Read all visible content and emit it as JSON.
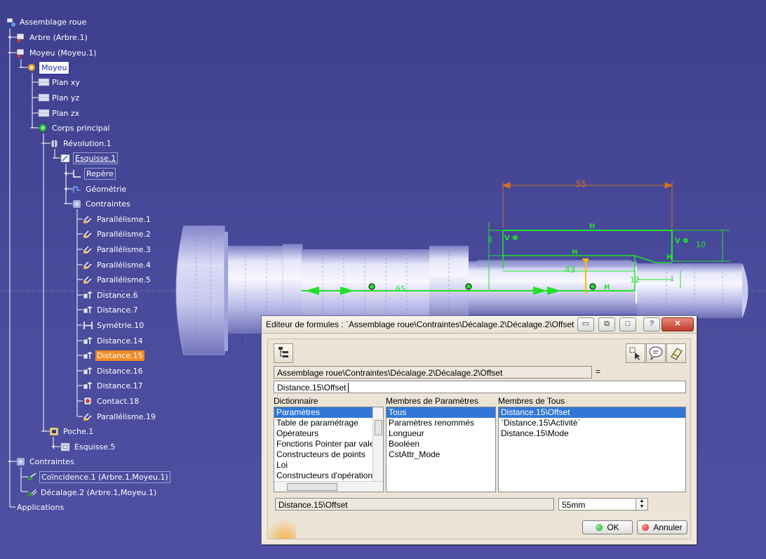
{
  "tree": {
    "items": [
      {
        "label": "Assemblage roue",
        "icon": "assembly-icon"
      },
      {
        "label": "Arbre (Arbre.1)",
        "icon": "product-icon"
      },
      {
        "label": "Moyeu (Moyeu.1)",
        "icon": "product-icon"
      },
      {
        "label": "Moyeu",
        "icon": "part-icon"
      },
      {
        "label": "Plan xy",
        "icon": "plane-icon"
      },
      {
        "label": "Plan yz",
        "icon": "plane-icon"
      },
      {
        "label": "Plan zx",
        "icon": "plane-icon"
      },
      {
        "label": "Corps principal",
        "icon": "body-icon"
      },
      {
        "label": "Révolution.1",
        "icon": "revolution-icon"
      },
      {
        "label": "Esquisse.1",
        "icon": "sketch-icon"
      },
      {
        "label": "Repère",
        "icon": "axis-icon"
      },
      {
        "label": "Géométrie",
        "icon": "geometry-icon"
      },
      {
        "label": "Contraintes",
        "icon": "constraints-icon"
      },
      {
        "label": "Parallélisme.1",
        "icon": "parallelism-icon"
      },
      {
        "label": "Parallélisme.2",
        "icon": "parallelism-icon"
      },
      {
        "label": "Parallélisme.3",
        "icon": "parallelism-icon"
      },
      {
        "label": "Parallélisme.4",
        "icon": "parallelism-icon"
      },
      {
        "label": "Parallélisme.5",
        "icon": "parallelism-icon"
      },
      {
        "label": "Distance.6",
        "icon": "distance-icon"
      },
      {
        "label": "Distance.7",
        "icon": "distance-icon"
      },
      {
        "label": "Symétrie.10",
        "icon": "symmetry-icon"
      },
      {
        "label": "Distance.14",
        "icon": "distance-icon"
      },
      {
        "label": "Distance.15",
        "icon": "distance-icon"
      },
      {
        "label": "Distance.16",
        "icon": "distance-icon"
      },
      {
        "label": "Distance.17",
        "icon": "distance-icon"
      },
      {
        "label": "Contact.18",
        "icon": "contact-icon"
      },
      {
        "label": "Parallélisme.19",
        "icon": "parallelism-icon"
      },
      {
        "label": "Poche.1",
        "icon": "pocket-icon"
      },
      {
        "label": "Esquisse.5",
        "icon": "sketch-icon"
      },
      {
        "label": "Contraintes",
        "icon": "constraints-icon"
      },
      {
        "label": "Coïncidence.1 (Arbre.1,Moyeu.1)",
        "icon": "coincidence-icon"
      },
      {
        "label": "Décalage.2 (Arbre.1,Moyeu.1)",
        "icon": "offset-icon"
      },
      {
        "label": "Applications",
        "icon": ""
      }
    ]
  },
  "dimensions": {
    "d55": "55",
    "d43": "43",
    "d8": "8",
    "d10": "10",
    "d12": "12",
    "d1": "1",
    "d65": "65"
  },
  "dialog": {
    "title": "Editeur de formules : `Assemblage roue\\Contraintes\\Décalage.2\\Décalage.2\\Offset`",
    "path": "Assemblage roue\\Contraintes\\Décalage.2\\Décalage.2\\Offset",
    "equals": "=",
    "formula": "Distance.15\\Offset",
    "dictionary_header": "Dictionnaire",
    "dictionary_items": [
      "Paramètres",
      "Table de paramétrage",
      "Opérateurs",
      "Fonctions Pointer par vale",
      "Constructeurs de points",
      "Loi",
      "Constructeurs d'opération"
    ],
    "members_params_header": "Membres de Paramètres",
    "members_params_items": [
      "Tous",
      "Paramètres renommés",
      "Longueur",
      "Booléen",
      "CstAttr_Mode"
    ],
    "members_all_header": "Membres de Tous",
    "members_all_items": [
      "Distance.15\\Offset",
      "`Distance.15\\Activité`",
      "Distance.15\\Mode"
    ],
    "selected_param": "Distance.15\\Offset",
    "value": "55mm",
    "ok_label": "OK",
    "cancel_label": "Annuler"
  },
  "colors": {
    "background": "#4a4b9c",
    "sketch_green": "#22e02a",
    "dimension_orange": "#d07020",
    "selection_orange": "#f08a24",
    "list_selection": "#3277d6"
  }
}
